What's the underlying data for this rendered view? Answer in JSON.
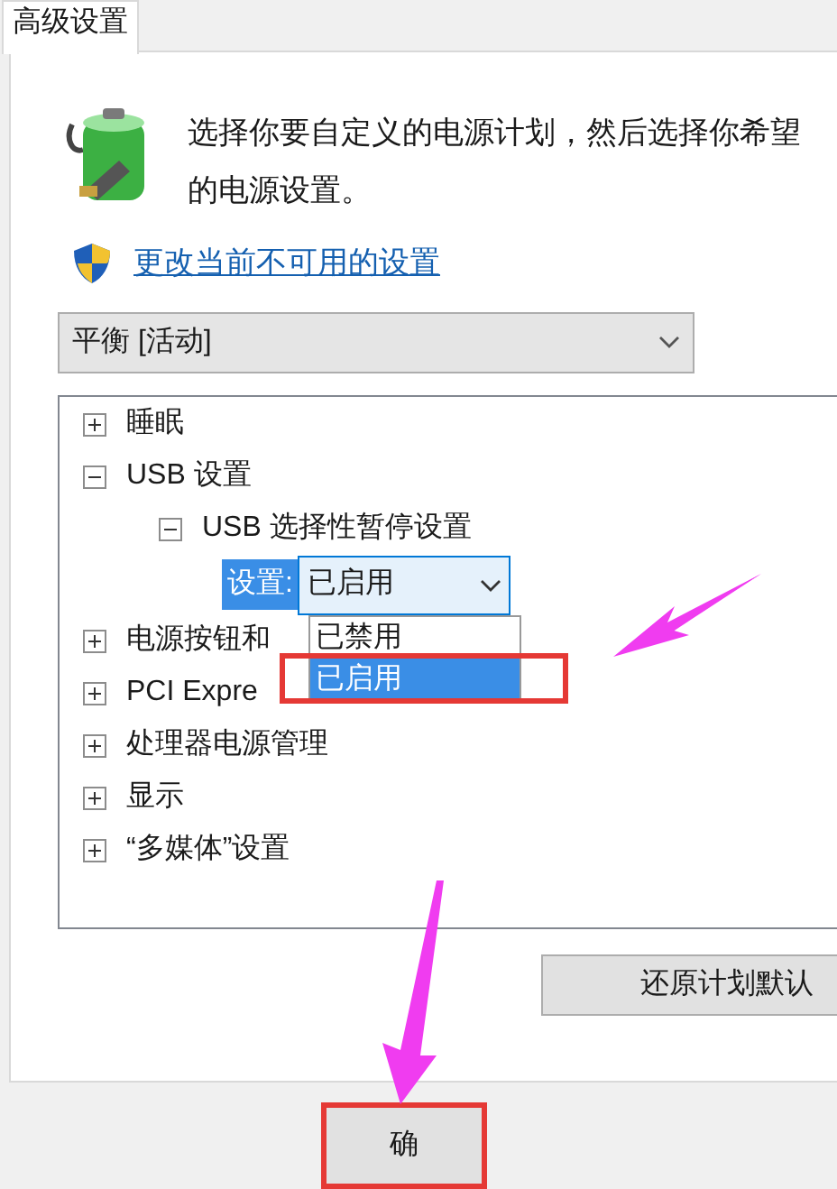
{
  "tabs": [
    {
      "label": "高级设置",
      "selected": true
    }
  ],
  "description": "选择你要自定义的电源计划，然后选择你希望",
  "description_line2": "的电源设置。",
  "link": "更改当前不可用的设置",
  "plan_select": {
    "value": "平衡 [活动]"
  },
  "tree": [
    {
      "kind": "group",
      "label": "睡眠",
      "expanded": false
    },
    {
      "kind": "group",
      "label": "USB 设置",
      "expanded": true,
      "children": [
        {
          "kind": "group",
          "label": "USB 选择性暂停设置",
          "expanded": true,
          "children": [
            {
              "kind": "setting",
              "label": "设置:",
              "value": "已启用",
              "options": [
                {
                  "label": "已禁用",
                  "selected": false
                },
                {
                  "label": "已启用",
                  "selected": true
                }
              ]
            }
          ]
        }
      ]
    },
    {
      "kind": "group",
      "label": "电源按钮和",
      "expanded": false
    },
    {
      "kind": "group",
      "label": "PCI Expre",
      "expanded": false
    },
    {
      "kind": "group",
      "label": "处理器电源管理",
      "expanded": false
    },
    {
      "kind": "group",
      "label": "显示",
      "expanded": false
    },
    {
      "kind": "group",
      "label": "“多媒体”设置",
      "expanded": false
    }
  ],
  "buttons": [
    {
      "label": "还原计划默认"
    },
    {
      "label": "确"
    }
  ]
}
